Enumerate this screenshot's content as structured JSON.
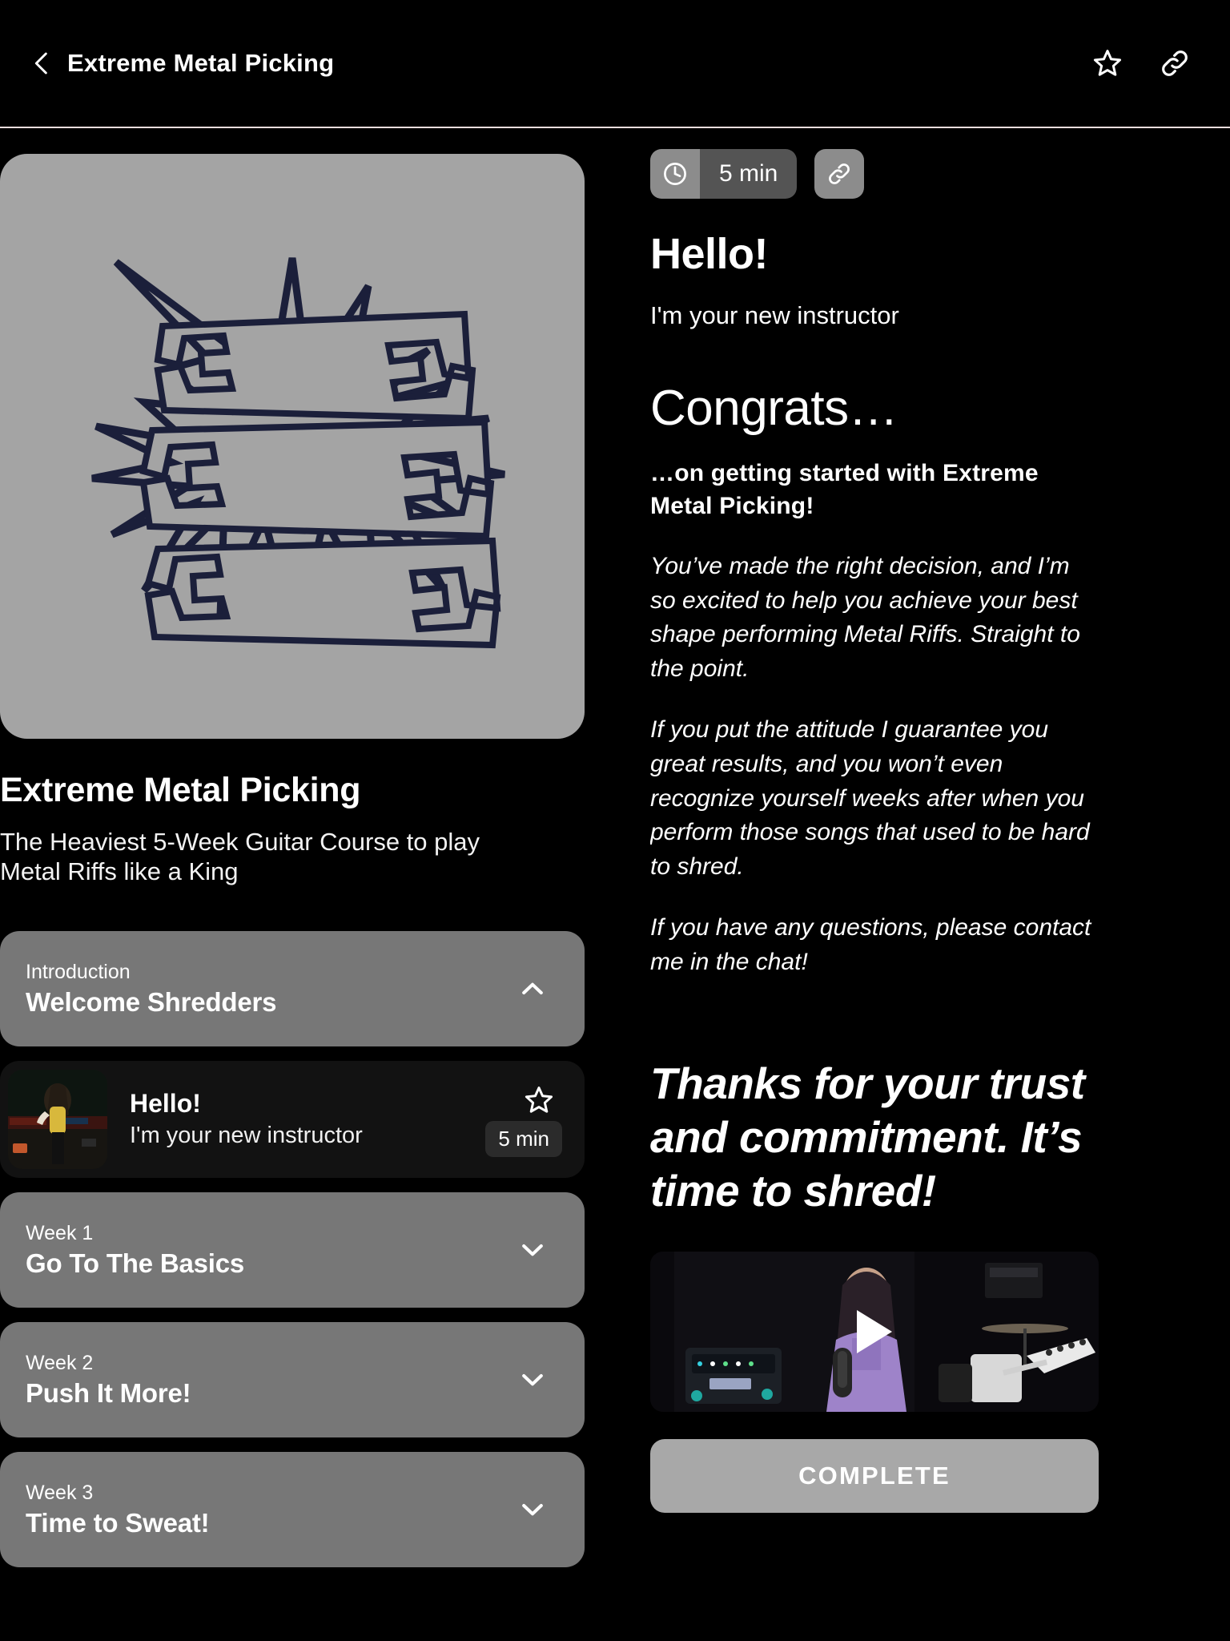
{
  "topbar": {
    "title": "Extreme Metal Picking",
    "back_icon": "chevron-left-icon",
    "favorite_icon": "star-outline-icon",
    "share_icon": "link-icon"
  },
  "course": {
    "cover_logo_lines": [
      "EXTREME",
      "METAL",
      "PICKING"
    ],
    "title": "Extreme Metal Picking",
    "subtitle": "The Heaviest 5-Week Guitar Course to play Metal Riffs like a King"
  },
  "curriculum": [
    {
      "kicker": "Introduction",
      "title": "Welcome Shredders",
      "chevron": "chevron-up-icon",
      "expanded": true,
      "lessons": [
        {
          "title": "Hello!",
          "subtitle": "I'm your new instructor",
          "duration": "5 min",
          "star_icon": "star-outline-icon"
        }
      ]
    },
    {
      "kicker": "Week 1",
      "title": "Go To The Basics",
      "chevron": "chevron-down-icon",
      "expanded": false,
      "lessons": []
    },
    {
      "kicker": "Week 2",
      "title": "Push It More!",
      "chevron": "chevron-down-icon",
      "expanded": false,
      "lessons": []
    },
    {
      "kicker": "Week 3",
      "title": "Time to Sweat!",
      "chevron": "chevron-down-icon",
      "expanded": false,
      "lessons": []
    }
  ],
  "lesson_detail": {
    "duration": "5 min",
    "duration_icon": "clock-icon",
    "link_icon": "link-icon",
    "heading": "Hello!",
    "subheading": "I'm your new instructor",
    "congrats_heading": "Congrats…",
    "congrats_bold": "…on getting started with Extreme Metal Picking!",
    "paragraph_1": "You’ve made the right decision, and I’m so excited to help you achieve your best shape performing Metal Riffs. Straight to the point.",
    "paragraph_2": "If you put the attitude I guarantee you great results, and you won’t even recognize yourself weeks after when you perform those songs that used to be hard to shred.",
    "paragraph_3": "If you have any questions, please contact me in the chat!",
    "thanks_heading": "Thanks for your trust and commitment. It’s time to shred!",
    "play_icon": "play-icon",
    "complete_label": "COMPLETE"
  },
  "colors": {
    "background": "#000000",
    "section_header": "#777777",
    "lesson_card": "#121212",
    "cover_background": "#a4a4a4",
    "logo_outline": "#1b1f3a",
    "complete_button": "#a8a8a8",
    "badge_icon": "#8c8c8c",
    "badge_text": "#545454"
  }
}
